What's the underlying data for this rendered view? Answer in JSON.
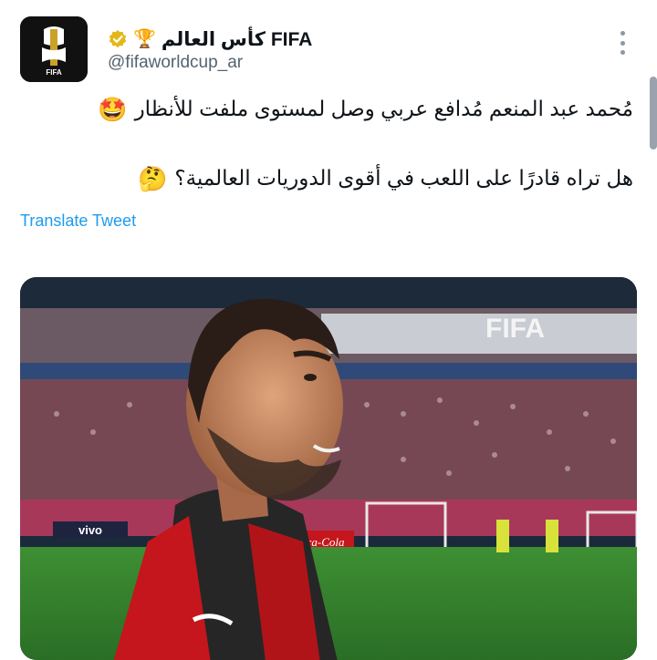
{
  "account": {
    "display_name": "كأس العالم FIFA",
    "handle": "@fifaworldcup_ar",
    "logo_text": "FIFA",
    "trophy_emoji": "🏆",
    "verified_icon": "gold-check-badge-icon"
  },
  "tweet": {
    "line1": "مُحمد عبد المنعم مُدافع عربي وصل لمستوى ملفت للأنظار",
    "line1_emoji": "🤩",
    "line2": "هل تراه قادرًا على اللعب في أقوى الدوريات العالمية؟",
    "line2_emoji": "🤔"
  },
  "translate_label": "Translate Tweet",
  "media": {
    "watermark": "FIFA",
    "board_brand_1": "vivo",
    "board_brand_2": "Coca-Cola",
    "pitch_color": "#2f7d2a",
    "shirt_color": "#c4161c"
  },
  "colors": {
    "link": "#1d9bf0",
    "text": "#0f1419",
    "muted": "#536471"
  }
}
